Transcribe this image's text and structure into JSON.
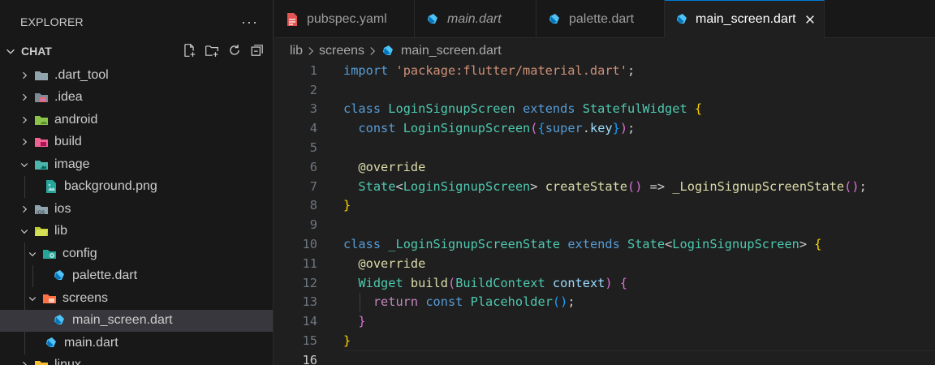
{
  "explorer": {
    "title": "EXPLORER",
    "more_label": "···",
    "section": "CHAT",
    "items": [
      {
        "label": ".dart_tool",
        "icon": "folder-icon"
      },
      {
        "label": ".idea",
        "icon": "folder-idea-icon"
      },
      {
        "label": "android",
        "icon": "folder-android-icon"
      },
      {
        "label": "build",
        "icon": "folder-build-icon"
      },
      {
        "label": "image",
        "icon": "folder-image-icon"
      },
      {
        "label": "background.png",
        "icon": "image-file-icon"
      },
      {
        "label": "ios",
        "icon": "folder-ios-icon"
      },
      {
        "label": "lib",
        "icon": "folder-lib-icon"
      },
      {
        "label": "config",
        "icon": "folder-config-icon"
      },
      {
        "label": "palette.dart",
        "icon": "dart-icon"
      },
      {
        "label": "screens",
        "icon": "folder-screens-icon"
      },
      {
        "label": "main_screen.dart",
        "icon": "dart-icon"
      },
      {
        "label": "main.dart",
        "icon": "dart-icon"
      },
      {
        "label": "linux",
        "icon": "folder-linux-icon"
      }
    ]
  },
  "tabs": [
    {
      "label": "pubspec.yaml",
      "icon": "yaml-icon"
    },
    {
      "label": "main.dart",
      "icon": "dart-icon"
    },
    {
      "label": "palette.dart",
      "icon": "dart-icon"
    },
    {
      "label": "main_screen.dart",
      "icon": "dart-icon"
    }
  ],
  "breadcrumb": [
    "lib",
    "screens",
    "main_screen.dart"
  ],
  "editor": {
    "line_numbers": [
      "1",
      "2",
      "3",
      "4",
      "5",
      "6",
      "7",
      "8",
      "9",
      "10",
      "11",
      "12",
      "13",
      "14",
      "15",
      "16"
    ],
    "tokens": {
      "import": "import",
      "pkg": "'package:flutter/material.dart'",
      "semi": ";",
      "class": "class",
      "login_signup_screen": "LoginSignupScreen",
      "extends": "extends",
      "stateful_widget": "StatefulWidget",
      "open_brace": "{",
      "close_brace": "}",
      "const": "const",
      "open_paren": "(",
      "close_paren": ")",
      "super": "super",
      "dot": ".",
      "key": "key",
      "override": "@override",
      "state": "State",
      "lt": "<",
      "gt": ">",
      "create_state": "createState",
      "arrow": "=>",
      "state_class": "_LoginSignupScreenState",
      "widget": "Widget",
      "build": "build",
      "build_context": "BuildContext",
      "context": "context",
      "return": "return",
      "placeholder": "Placeholder"
    }
  }
}
